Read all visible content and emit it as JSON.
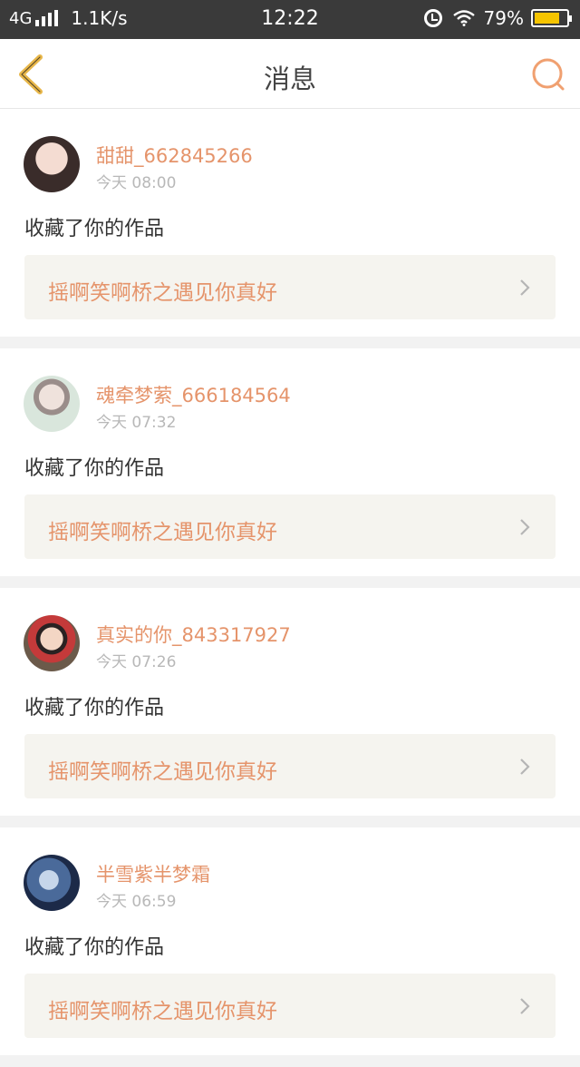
{
  "status_bar": {
    "network": "4G",
    "speed": "1.1K/s",
    "time": "12:22",
    "battery": "79%",
    "battery_level": 0.79,
    "icons": [
      "signal-icon",
      "alarm-icon",
      "wifi-icon",
      "battery-icon"
    ]
  },
  "nav": {
    "title": "消息",
    "back_icon": "chevron-left-icon",
    "search_icon": "search-icon",
    "accent_color": "#e8b74a",
    "search_color": "#f0a070"
  },
  "colors": {
    "accent": "#e5946b",
    "muted": "#b8b8b8",
    "card_link_bg": "#f5f4ef"
  },
  "messages": [
    {
      "username": "甜甜_662845266",
      "time": "今天 08:00",
      "action": "收藏了你的作品",
      "work_title": "摇啊笑啊桥之遇见你真好"
    },
    {
      "username": "魂牵梦萦_666184564",
      "time": "今天 07:32",
      "action": "收藏了你的作品",
      "work_title": "摇啊笑啊桥之遇见你真好"
    },
    {
      "username": "真实的你_843317927",
      "time": "今天 07:26",
      "action": "收藏了你的作品",
      "work_title": "摇啊笑啊桥之遇见你真好"
    },
    {
      "username": "半雪紫半梦霜",
      "time": "今天 06:59",
      "action": "收藏了你的作品",
      "work_title": "摇啊笑啊桥之遇见你真好"
    }
  ]
}
